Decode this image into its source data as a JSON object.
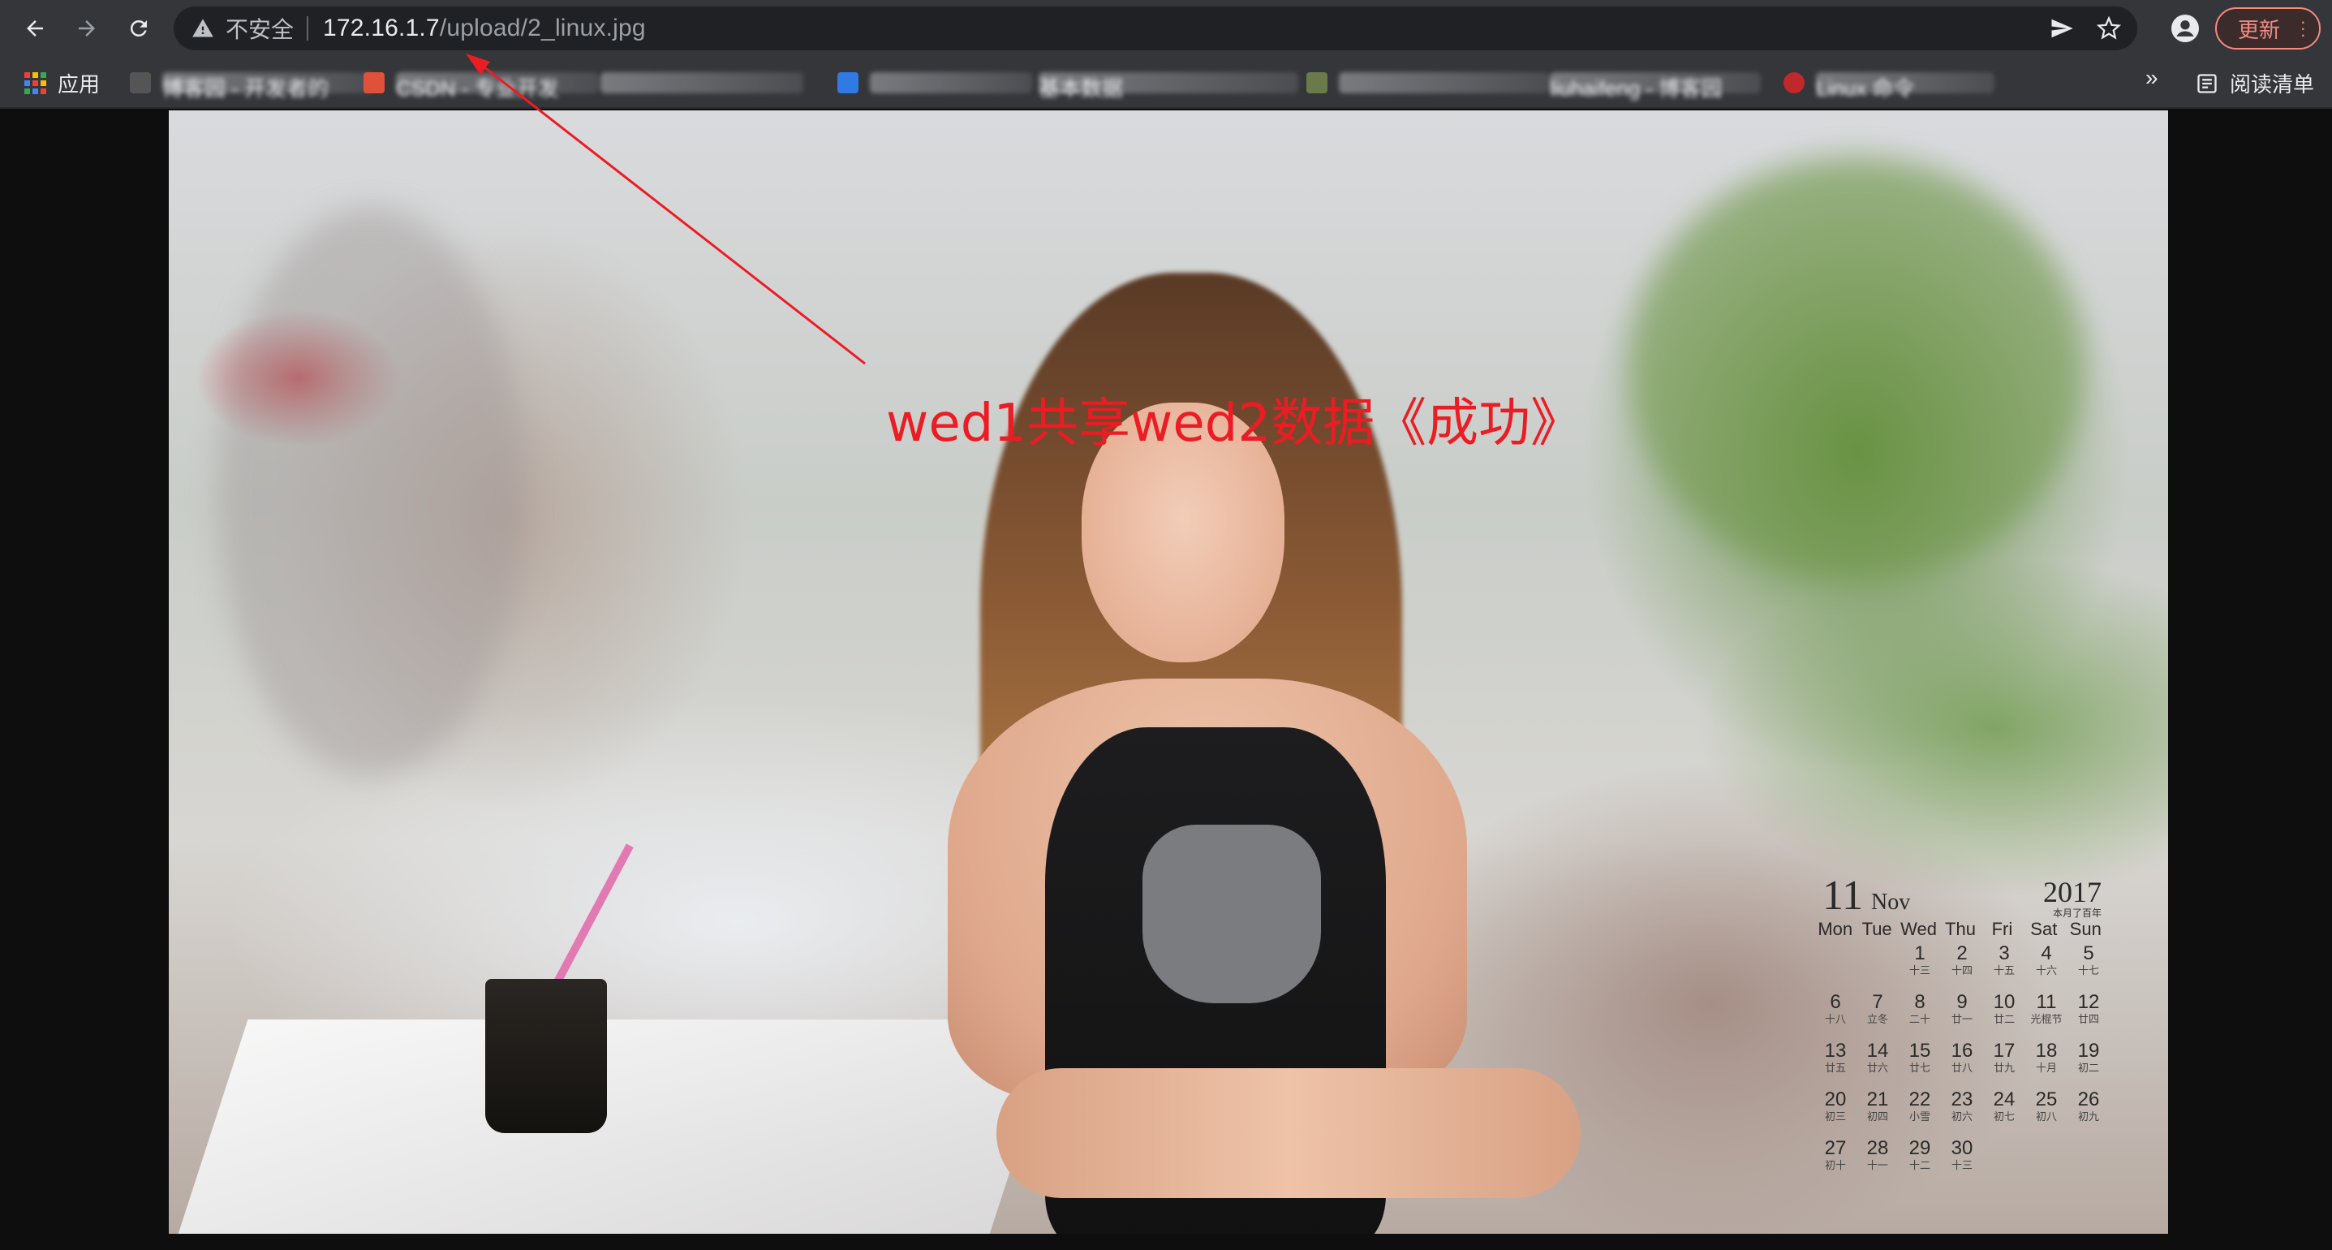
{
  "browser": {
    "security_label": "不安全",
    "url_host": "172.16.1.7",
    "url_path": "/upload/2_linux.jpg",
    "update_label": "更新",
    "reading_list_label": "阅读清单",
    "more_bookmarks_label": "»"
  },
  "bookmarks": [
    {
      "label": "应用"
    },
    {
      "label": "博客园 - 开发者的"
    },
    {
      "label": "CSDN - 专业开发"
    },
    {
      "label": ""
    },
    {
      "label": ""
    },
    {
      "label": "基本数据"
    },
    {
      "label": ""
    },
    {
      "label": "liuhaifeng - 博客园"
    },
    {
      "label": "Linux 命令"
    }
  ],
  "annotation": {
    "text": "wed1共享wed2数据《成功》",
    "color": "#ec1c24"
  },
  "calendar": {
    "month_number": "11",
    "month_name": "Nov",
    "year": "2017",
    "tag": "本月了百年",
    "weekdays": [
      "Mon",
      "Tue",
      "Wed",
      "Thu",
      "Fri",
      "Sat",
      "Sun"
    ],
    "days": [
      {
        "d": "",
        "l": ""
      },
      {
        "d": "",
        "l": ""
      },
      {
        "d": "1",
        "l": "十三"
      },
      {
        "d": "2",
        "l": "十四"
      },
      {
        "d": "3",
        "l": "十五"
      },
      {
        "d": "4",
        "l": "十六"
      },
      {
        "d": "5",
        "l": "十七"
      },
      {
        "d": "6",
        "l": "十八"
      },
      {
        "d": "7",
        "l": "立冬"
      },
      {
        "d": "8",
        "l": "二十"
      },
      {
        "d": "9",
        "l": "廿一"
      },
      {
        "d": "10",
        "l": "廿二"
      },
      {
        "d": "11",
        "l": "光棍节"
      },
      {
        "d": "12",
        "l": "廿四"
      },
      {
        "d": "13",
        "l": "廿五"
      },
      {
        "d": "14",
        "l": "廿六"
      },
      {
        "d": "15",
        "l": "廿七"
      },
      {
        "d": "16",
        "l": "廿八"
      },
      {
        "d": "17",
        "l": "廿九"
      },
      {
        "d": "18",
        "l": "十月"
      },
      {
        "d": "19",
        "l": "初二"
      },
      {
        "d": "20",
        "l": "初三"
      },
      {
        "d": "21",
        "l": "初四"
      },
      {
        "d": "22",
        "l": "小雪"
      },
      {
        "d": "23",
        "l": "初六"
      },
      {
        "d": "24",
        "l": "初七"
      },
      {
        "d": "25",
        "l": "初八"
      },
      {
        "d": "26",
        "l": "初九"
      },
      {
        "d": "27",
        "l": "初十"
      },
      {
        "d": "28",
        "l": "十一"
      },
      {
        "d": "29",
        "l": "十二"
      },
      {
        "d": "30",
        "l": "十三"
      }
    ]
  },
  "colors": {
    "toolbar_bg": "#35363a",
    "omnibox_bg": "#202124",
    "update_accent": "#f28b82",
    "page_bg": "#0e0e0e"
  },
  "icons": {
    "back": "arrow-left-icon",
    "forward": "arrow-right-icon",
    "reload": "reload-icon",
    "warning": "warning-triangle-icon",
    "send": "send-icon",
    "bookmark_star": "star-icon",
    "profile": "person-icon",
    "apps": "apps-grid-icon",
    "reading_list": "reading-list-icon"
  }
}
